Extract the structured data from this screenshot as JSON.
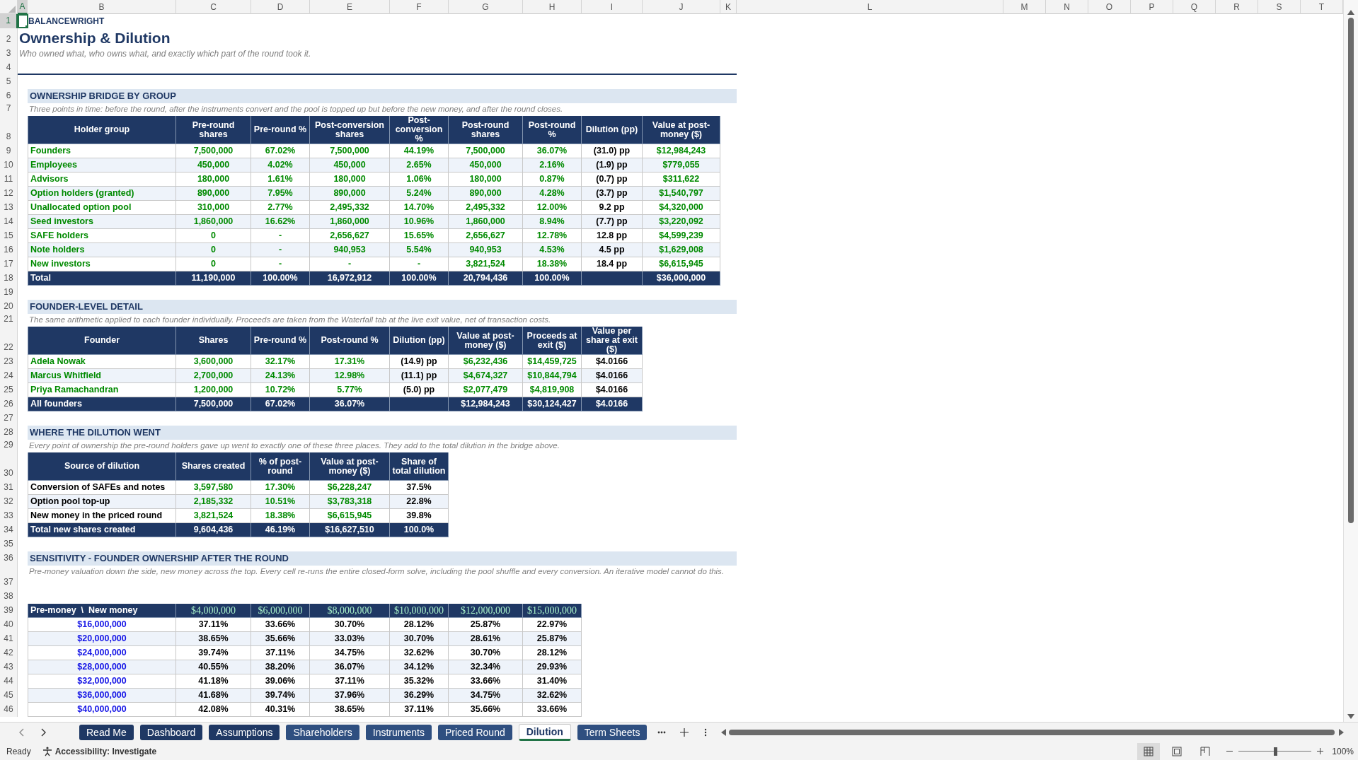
{
  "columns": [
    {
      "label": "A",
      "selected": true
    },
    {
      "label": "B",
      "selected": false
    },
    {
      "label": "C",
      "selected": false
    },
    {
      "label": "D",
      "selected": false
    },
    {
      "label": "E",
      "selected": false
    },
    {
      "label": "F",
      "selected": false
    },
    {
      "label": "G",
      "selected": false
    },
    {
      "label": "H",
      "selected": false
    },
    {
      "label": "I",
      "selected": false
    },
    {
      "label": "J",
      "selected": false
    },
    {
      "label": "K",
      "selected": false
    },
    {
      "label": "L",
      "selected": false
    },
    {
      "label": "M",
      "selected": false
    },
    {
      "label": "N",
      "selected": false
    },
    {
      "label": "O",
      "selected": false
    },
    {
      "label": "P",
      "selected": false
    },
    {
      "label": "Q",
      "selected": false
    },
    {
      "label": "R",
      "selected": false
    },
    {
      "label": "S",
      "selected": false
    },
    {
      "label": "T",
      "selected": false
    }
  ],
  "row_headers": [
    {
      "label": "1",
      "selected": true
    },
    {
      "label": "2",
      "selected": false
    },
    {
      "label": "3",
      "selected": false
    },
    {
      "label": "4",
      "selected": false
    },
    {
      "label": "5",
      "selected": false
    },
    {
      "label": "6",
      "selected": false
    },
    {
      "label": "7",
      "selected": false
    },
    {
      "label": "8",
      "selected": false
    },
    {
      "label": "9",
      "selected": false
    },
    {
      "label": "10",
      "selected": false
    },
    {
      "label": "11",
      "selected": false
    },
    {
      "label": "12",
      "selected": false
    },
    {
      "label": "13",
      "selected": false
    },
    {
      "label": "14",
      "selected": false
    },
    {
      "label": "15",
      "selected": false
    },
    {
      "label": "16",
      "selected": false
    },
    {
      "label": "17",
      "selected": false
    },
    {
      "label": "18",
      "selected": false
    },
    {
      "label": "19",
      "selected": false
    },
    {
      "label": "20",
      "selected": false
    },
    {
      "label": "21",
      "selected": false
    },
    {
      "label": "22",
      "selected": false
    },
    {
      "label": "23",
      "selected": false
    },
    {
      "label": "24",
      "selected": false
    },
    {
      "label": "25",
      "selected": false
    },
    {
      "label": "26",
      "selected": false
    },
    {
      "label": "27",
      "selected": false
    },
    {
      "label": "28",
      "selected": false
    },
    {
      "label": "29",
      "selected": false
    },
    {
      "label": "30",
      "selected": false
    },
    {
      "label": "31",
      "selected": false
    },
    {
      "label": "32",
      "selected": false
    },
    {
      "label": "33",
      "selected": false
    },
    {
      "label": "34",
      "selected": false
    },
    {
      "label": "35",
      "selected": false
    },
    {
      "label": "36",
      "selected": false
    },
    {
      "label": "37",
      "selected": false
    },
    {
      "label": "38",
      "selected": false
    },
    {
      "label": "39",
      "selected": false
    },
    {
      "label": "40",
      "selected": false
    },
    {
      "label": "41",
      "selected": false
    },
    {
      "label": "42",
      "selected": false
    },
    {
      "label": "43",
      "selected": false
    },
    {
      "label": "44",
      "selected": false
    },
    {
      "label": "45",
      "selected": false
    },
    {
      "label": "46",
      "selected": false
    }
  ],
  "brand": "BALANCEWRIGHT",
  "title": "Ownership & Dilution",
  "subtitle": "Who owned what, who owns what, and exactly which part of the round took it.",
  "sections": [
    {
      "heading": "OWNERSHIP BRIDGE BY GROUP",
      "note": "Three points in time: before the round, after the instruments convert and the pool is topped up but before the new money, and after the round closes.",
      "table": {
        "kind": "list",
        "columns": [
          {
            "label": "Holder group",
            "kind": "linked"
          },
          {
            "label": "Pre-round shares",
            "kind": "linked"
          },
          {
            "label": "Pre-round %",
            "kind": "linked"
          },
          {
            "label": "Post-conversion shares",
            "kind": "linked"
          },
          {
            "label": "Post-conversion %",
            "kind": "linked"
          },
          {
            "label": "Post-round shares",
            "kind": "linked"
          },
          {
            "label": "Post-round %",
            "kind": "linked"
          },
          {
            "label": "Dilution (pp)",
            "kind": "calc"
          },
          {
            "label": "Value at post-money ($)",
            "kind": "linked"
          }
        ],
        "rows": [
          {
            "cells": [
              "Founders",
              "7,500,000",
              "67.02%",
              "7,500,000",
              "44.19%",
              "7,500,000",
              "36.07%",
              "(31.0) pp",
              "$12,984,243"
            ]
          },
          {
            "cells": [
              "Employees",
              "450,000",
              "4.02%",
              "450,000",
              "2.65%",
              "450,000",
              "2.16%",
              "(1.9) pp",
              "$779,055"
            ]
          },
          {
            "cells": [
              "Advisors",
              "180,000",
              "1.61%",
              "180,000",
              "1.06%",
              "180,000",
              "0.87%",
              "(0.7) pp",
              "$311,622"
            ]
          },
          {
            "cells": [
              "Option holders (granted)",
              "890,000",
              "7.95%",
              "890,000",
              "5.24%",
              "890,000",
              "4.28%",
              "(3.7) pp",
              "$1,540,797"
            ]
          },
          {
            "cells": [
              "Unallocated option pool",
              "310,000",
              "2.77%",
              "2,495,332",
              "14.70%",
              "2,495,332",
              "12.00%",
              "9.2 pp",
              "$4,320,000"
            ]
          },
          {
            "cells": [
              "Seed investors",
              "1,860,000",
              "16.62%",
              "1,860,000",
              "10.96%",
              "1,860,000",
              "8.94%",
              "(7.7) pp",
              "$3,220,092"
            ]
          },
          {
            "cells": [
              "SAFE holders",
              "0",
              "-",
              "2,656,627",
              "15.65%",
              "2,656,627",
              "12.78%",
              "12.8 pp",
              "$4,599,239"
            ]
          },
          {
            "cells": [
              "Note holders",
              "0",
              "-",
              "940,953",
              "5.54%",
              "940,953",
              "4.53%",
              "4.5 pp",
              "$1,629,008"
            ]
          },
          {
            "cells": [
              "New investors",
              "0",
              "-",
              "-",
              "-",
              "3,821,524",
              "18.38%",
              "18.4 pp",
              "$6,615,945"
            ]
          }
        ],
        "total": {
          "cells": [
            "Total",
            "11,190,000",
            "100.00%",
            "16,972,912",
            "100.00%",
            "20,794,436",
            "100.00%",
            null,
            "$36,000,000"
          ]
        }
      }
    },
    {
      "heading": "FOUNDER-LEVEL DETAIL",
      "note": "The same arithmetic applied to each founder individually. Proceeds are taken from the Waterfall tab at the live exit value, net of transaction costs.",
      "table": {
        "kind": "list",
        "columns": [
          {
            "label": "Founder",
            "kind": "linked"
          },
          {
            "label": "Shares",
            "kind": "linked"
          },
          {
            "label": "Pre-round %",
            "kind": "linked"
          },
          {
            "label": "Post-round %",
            "kind": "linked"
          },
          {
            "label": "Dilution (pp)",
            "kind": "calc"
          },
          {
            "label": "Value at post-money ($)",
            "kind": "linked"
          },
          {
            "label": "Proceeds at exit ($)",
            "kind": "linked"
          },
          {
            "label": "Value per share at exit ($)",
            "kind": "calc"
          }
        ],
        "rows": [
          {
            "cells": [
              "Adela Nowak",
              "3,600,000",
              "32.17%",
              "17.31%",
              "(14.9) pp",
              "$6,232,436",
              "$14,459,725",
              "$4.0166"
            ]
          },
          {
            "cells": [
              "Marcus Whitfield",
              "2,700,000",
              "24.13%",
              "12.98%",
              "(11.1) pp",
              "$4,674,327",
              "$10,844,794",
              "$4.0166"
            ]
          },
          {
            "cells": [
              "Priya Ramachandran",
              "1,200,000",
              "10.72%",
              "5.77%",
              "(5.0) pp",
              "$2,077,479",
              "$4,819,908",
              "$4.0166"
            ]
          }
        ],
        "total": {
          "cells": [
            "All founders",
            "7,500,000",
            "67.02%",
            "36.07%",
            null,
            "$12,984,243",
            "$30,124,427",
            "$4.0166"
          ]
        }
      }
    },
    {
      "heading": "WHERE THE DILUTION WENT",
      "note": "Every point of ownership the pre-round holders gave up went to exactly one of these three places. They add to the total dilution in the bridge above.",
      "table": {
        "kind": "list",
        "columns": [
          {
            "label": "Source of dilution",
            "kind": "calc"
          },
          {
            "label": "Shares created",
            "kind": "linked"
          },
          {
            "label": "% of post-round",
            "kind": "linked"
          },
          {
            "label": "Value at post-money ($)",
            "kind": "linked"
          },
          {
            "label": "Share of total dilution",
            "kind": "calc"
          }
        ],
        "rows": [
          {
            "cells": [
              "Conversion of SAFEs and notes",
              "3,597,580",
              "17.30%",
              "$6,228,247",
              "37.5%"
            ]
          },
          {
            "cells": [
              "Option pool top-up",
              "2,185,332",
              "10.51%",
              "$3,783,318",
              "22.8%"
            ]
          },
          {
            "cells": [
              "New money in the priced round",
              "3,821,524",
              "18.38%",
              "$6,615,945",
              "39.8%"
            ]
          }
        ],
        "total": {
          "cells": [
            "Total new shares created",
            "9,604,436",
            "46.19%",
            "$16,627,510",
            "100.0%"
          ]
        }
      }
    },
    {
      "heading": "SENSITIVITY - FOUNDER OWNERSHIP AFTER THE ROUND",
      "note": "Pre-money valuation down the side, new money across the top. Every cell re-runs the entire closed-form solve, including the pool shuffle and every conversion. An iterative model cannot do this.",
      "table": {
        "kind": "matrix",
        "corner": "Pre-money  \\  New money",
        "columns": [
          "$4,000,000",
          "$6,000,000",
          "$8,000,000",
          "$10,000,000",
          "$12,000,000",
          "$15,000,000"
        ],
        "rows": [
          {
            "label": "$16,000,000",
            "cells": [
              "37.11%",
              "33.66%",
              "30.70%",
              "28.12%",
              "25.87%",
              "22.97%"
            ]
          },
          {
            "label": "$20,000,000",
            "cells": [
              "38.65%",
              "35.66%",
              "33.03%",
              "30.70%",
              "28.61%",
              "25.87%"
            ]
          },
          {
            "label": "$24,000,000",
            "cells": [
              "39.74%",
              "37.11%",
              "34.75%",
              "32.62%",
              "30.70%",
              "28.12%"
            ]
          },
          {
            "label": "$28,000,000",
            "cells": [
              "40.55%",
              "38.20%",
              "36.07%",
              "34.12%",
              "32.34%",
              "29.93%"
            ]
          },
          {
            "label": "$32,000,000",
            "cells": [
              "41.18%",
              "39.06%",
              "37.11%",
              "35.32%",
              "33.66%",
              "31.40%"
            ]
          },
          {
            "label": "$36,000,000",
            "cells": [
              "41.68%",
              "39.74%",
              "37.96%",
              "36.29%",
              "34.75%",
              "32.62%"
            ]
          },
          {
            "label": "$40,000,000",
            "cells": [
              "42.08%",
              "40.31%",
              "38.65%",
              "37.11%",
              "35.66%",
              "33.66%"
            ]
          }
        ]
      }
    }
  ],
  "sheet_tabs": [
    {
      "label": "Read Me",
      "selected": false,
      "color": "#1f3864"
    },
    {
      "label": "Dashboard",
      "selected": false,
      "color": "#1f3864"
    },
    {
      "label": "Assumptions",
      "selected": false,
      "color": "#1f3864"
    },
    {
      "label": "Shareholders",
      "selected": false,
      "color": "#2f4f80"
    },
    {
      "label": "Instruments",
      "selected": false,
      "color": "#2f4f80"
    },
    {
      "label": "Priced Round",
      "selected": false,
      "color": "#2f4f80"
    },
    {
      "label": "Dilution",
      "selected": true
    },
    {
      "label": "Term Sheets",
      "selected": false,
      "color": "#2f4f80"
    }
  ],
  "status_bar": {
    "mode": "Ready",
    "accessibility": "Accessibility: Investigate",
    "views": [
      {
        "kind": "normal",
        "selected": true
      },
      {
        "kind": "page_layout",
        "selected": false
      },
      {
        "kind": "page_break",
        "selected": false
      }
    ],
    "zoom": {
      "level": 0.5,
      "label": "100%"
    }
  }
}
